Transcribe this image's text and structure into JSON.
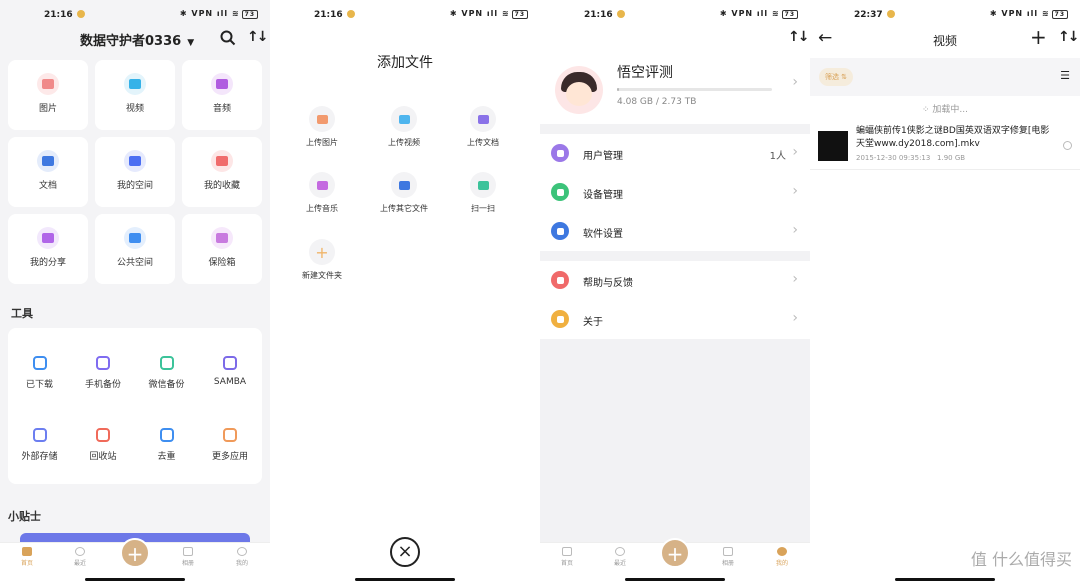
{
  "status": {
    "time1": "21:16",
    "time2": "21:16",
    "time3": "21:16",
    "time4": "22:37",
    "icons": "✱ VPN ıll ≋",
    "battery": "73"
  },
  "home": {
    "title": "数据守护者0336",
    "grid": [
      {
        "label": "图片",
        "color": "#f08a8a",
        "bg": "#fde9e9"
      },
      {
        "label": "视频",
        "color": "#35b2e8",
        "bg": "#e3f4fb"
      },
      {
        "label": "音频",
        "color": "#b05ce0",
        "bg": "#f4e6fb"
      },
      {
        "label": "文档",
        "color": "#3e78e0",
        "bg": "#e4ecfb"
      },
      {
        "label": "我的空间",
        "color": "#4b6ef2",
        "bg": "#e6eafd"
      },
      {
        "label": "我的收藏",
        "color": "#f06c6c",
        "bg": "#fde6e6"
      },
      {
        "label": "我的分享",
        "color": "#b065e8",
        "bg": "#f2e8fc"
      },
      {
        "label": "公共空间",
        "color": "#3f8ef0",
        "bg": "#e4effd"
      },
      {
        "label": "保险箱",
        "color": "#c87adf",
        "bg": "#f6e8fb"
      }
    ],
    "tools_title": "工具",
    "tools": [
      {
        "label": "已下载",
        "color": "#3e8ef0"
      },
      {
        "label": "手机备份",
        "color": "#7f6cf0"
      },
      {
        "label": "微信备份",
        "color": "#3cc39a"
      },
      {
        "label": "SAMBA",
        "color": "#7c6ae8"
      },
      {
        "label": "外部存储",
        "color": "#6c7ef0"
      },
      {
        "label": "回收站",
        "color": "#f06a5a"
      },
      {
        "label": "去重",
        "color": "#3e8ef0"
      },
      {
        "label": "更多应用",
        "color": "#f09a5a"
      }
    ],
    "tips_title": "小贴士",
    "tabs": [
      "首页",
      "最近",
      "",
      "相册",
      "我的"
    ]
  },
  "add": {
    "title": "添加文件",
    "items": [
      {
        "label": "上传图片",
        "color": "#f29a6e"
      },
      {
        "label": "上传视频",
        "color": "#4eb5ee"
      },
      {
        "label": "上传文档",
        "color": "#8a72e8"
      },
      {
        "label": "上传音乐",
        "color": "#c46ae0"
      },
      {
        "label": "上传其它文件",
        "color": "#3e78e0"
      },
      {
        "label": "扫一扫",
        "color": "#3cc39a"
      },
      {
        "label": "新建文件夹",
        "color": "#f0b56a"
      }
    ],
    "close": "×"
  },
  "me": {
    "name": "悟空评测",
    "quota": "4.08 GB / 2.73 TB",
    "quota_fraction": 0.015,
    "menu": [
      {
        "label": "用户管理",
        "value": "1人",
        "color": "#9b78e8"
      },
      {
        "label": "设备管理",
        "value": "",
        "color": "#3cc37a"
      },
      {
        "label": "软件设置",
        "value": "",
        "color": "#3e78e0"
      },
      {
        "label": "帮助与反馈",
        "value": "",
        "color": "#f06a6a"
      },
      {
        "label": "关于",
        "value": "",
        "color": "#f0b040"
      }
    ]
  },
  "video": {
    "title": "视频",
    "filter": "筛选",
    "loading": "加载中...",
    "file_name": "蝙蝠侠前传1侠影之谜BD国英双语双字修复[电影天堂www.dy2018.com].mkv",
    "file_date": "2015-12-30 09:35:13",
    "file_size": "1.90 GB"
  },
  "watermark": "值 什么值得买"
}
